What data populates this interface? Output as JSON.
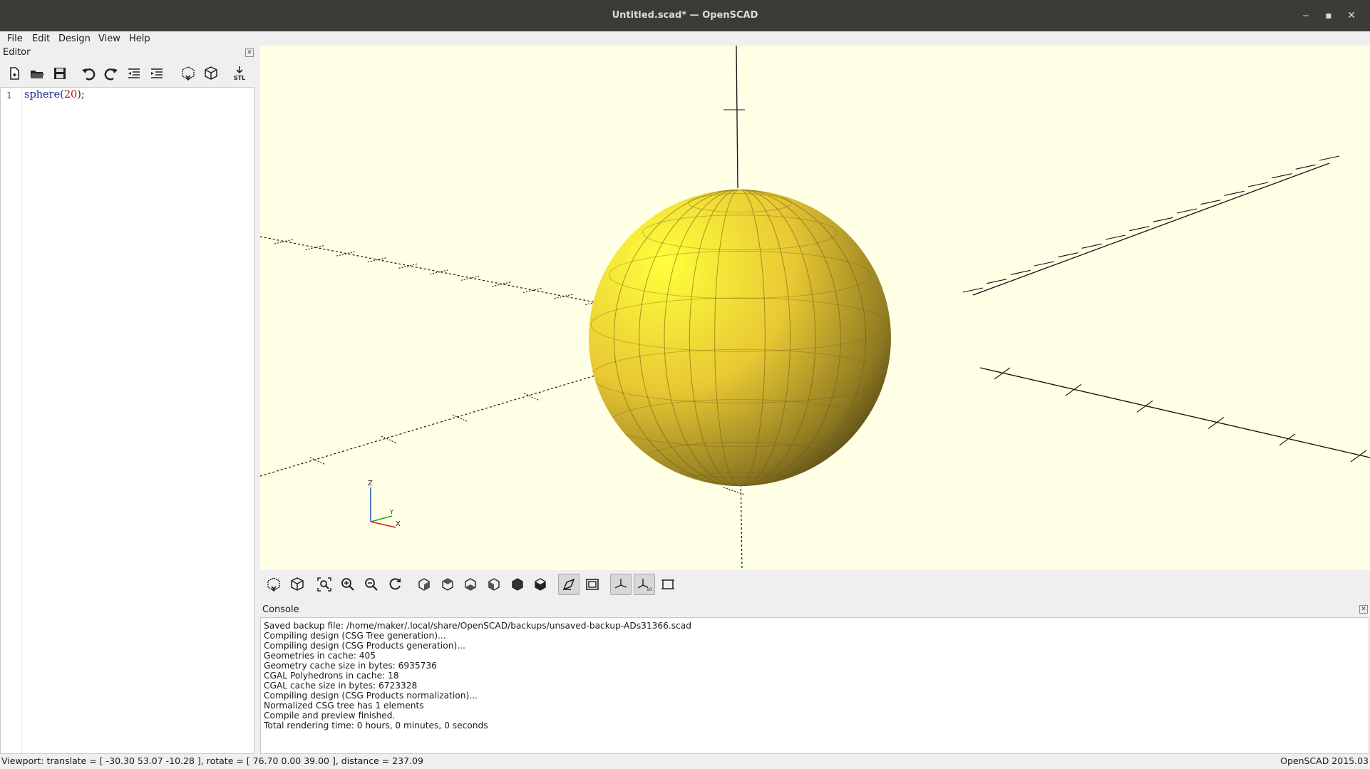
{
  "window": {
    "title": "Untitled.scad* — OpenSCAD",
    "minimize": "‒",
    "maximize": "▪",
    "close": "✕"
  },
  "menu": [
    "File",
    "Edit",
    "Design",
    "View",
    "Help"
  ],
  "editor": {
    "title": "Editor",
    "line_number": "1",
    "code_keyword": "sphere(",
    "code_number": "20",
    "code_tail": ");",
    "toolbar_icons": [
      "new-file-icon",
      "open-file-icon",
      "save-icon",
      "undo-icon",
      "redo-icon",
      "unindent-icon",
      "indent-icon",
      "preview-icon",
      "render-icon",
      "export-stl-icon"
    ],
    "stl_label": "STL"
  },
  "viewport": {
    "background": "#ffffe5",
    "model_color": "#f9d72c",
    "axes_indicator": {
      "z": "Z",
      "y": "Y",
      "x": "X"
    }
  },
  "view_toolbar_icons": [
    "preview-icon",
    "render-icon",
    "view-all-icon",
    "zoom-in-icon",
    "zoom-out-icon",
    "reset-view-icon",
    "view-right-icon",
    "view-top-icon",
    "view-bottom-icon",
    "view-left-icon",
    "view-front-icon",
    "view-back-icon",
    "perspective-icon",
    "orthogonal-icon",
    "show-axes-icon",
    "show-scale-markers-icon",
    "show-edges-icon"
  ],
  "console": {
    "title": "Console",
    "lines": [
      "Saved backup file: /home/maker/.local/share/OpenSCAD/backups/unsaved-backup-ADs31366.scad",
      "Compiling design (CSG Tree generation)...",
      "Compiling design (CSG Products generation)...",
      "Geometries in cache: 405",
      "Geometry cache size in bytes: 6935736",
      "CGAL Polyhedrons in cache: 18",
      "CGAL cache size in bytes: 6723328",
      "Compiling design (CSG Products normalization)...",
      "Normalized CSG tree has 1 elements",
      "Compile and preview finished.",
      "Total rendering time: 0 hours, 0 minutes, 0 seconds"
    ]
  },
  "status": {
    "viewport_info": "Viewport: translate = [ -30.30 53.07 -10.28 ], rotate = [ 76.70 0.00 39.00 ], distance = 237.09",
    "version": "OpenSCAD 2015.03"
  }
}
